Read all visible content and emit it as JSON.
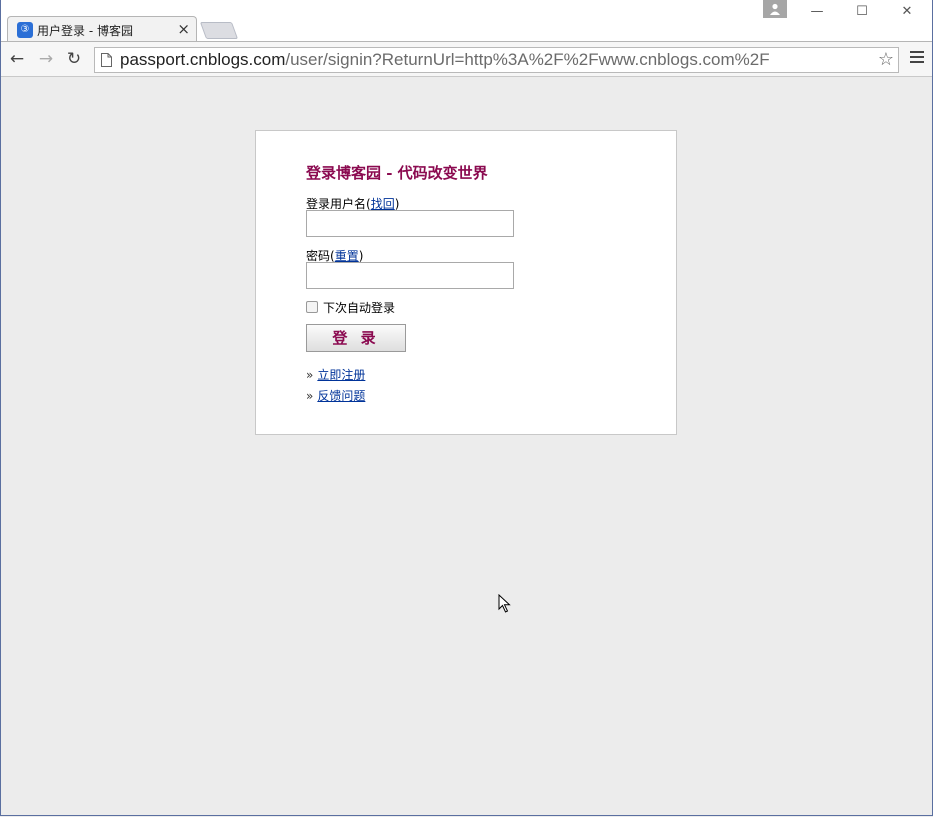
{
  "browser": {
    "tab_title": "用户登录 - 博客园",
    "tab_close": "×",
    "favicon_glyph": "③",
    "url_host": "passport.cnblogs.com",
    "url_rest": "/user/signin?ReturnUrl=http%3A%2F%2Fwww.cnblogs.com%2F",
    "star_glyph": "☆",
    "back_glyph": "←",
    "forward_glyph": "→",
    "reload_glyph": "↻",
    "minimize_glyph": "—",
    "maximize_glyph": "☐",
    "close_glyph": "✕"
  },
  "login": {
    "title": "登录博客园 - 代码改变世界",
    "username_label": "登录用户名(",
    "username_link": "找回",
    "username_label_end": ")",
    "username_value": "",
    "password_label": "密码(",
    "password_link": "重置",
    "password_label_end": ")",
    "password_value": "",
    "remember_label": "下次自动登录",
    "remember_checked": false,
    "submit_label": "登 录",
    "links": [
      {
        "prefix": "»",
        "label": "立即注册"
      },
      {
        "prefix": "»",
        "label": "反馈问题"
      }
    ]
  },
  "colors": {
    "title_color": "#8b0a50",
    "link_color": "#003399",
    "page_background": "#ececec"
  }
}
